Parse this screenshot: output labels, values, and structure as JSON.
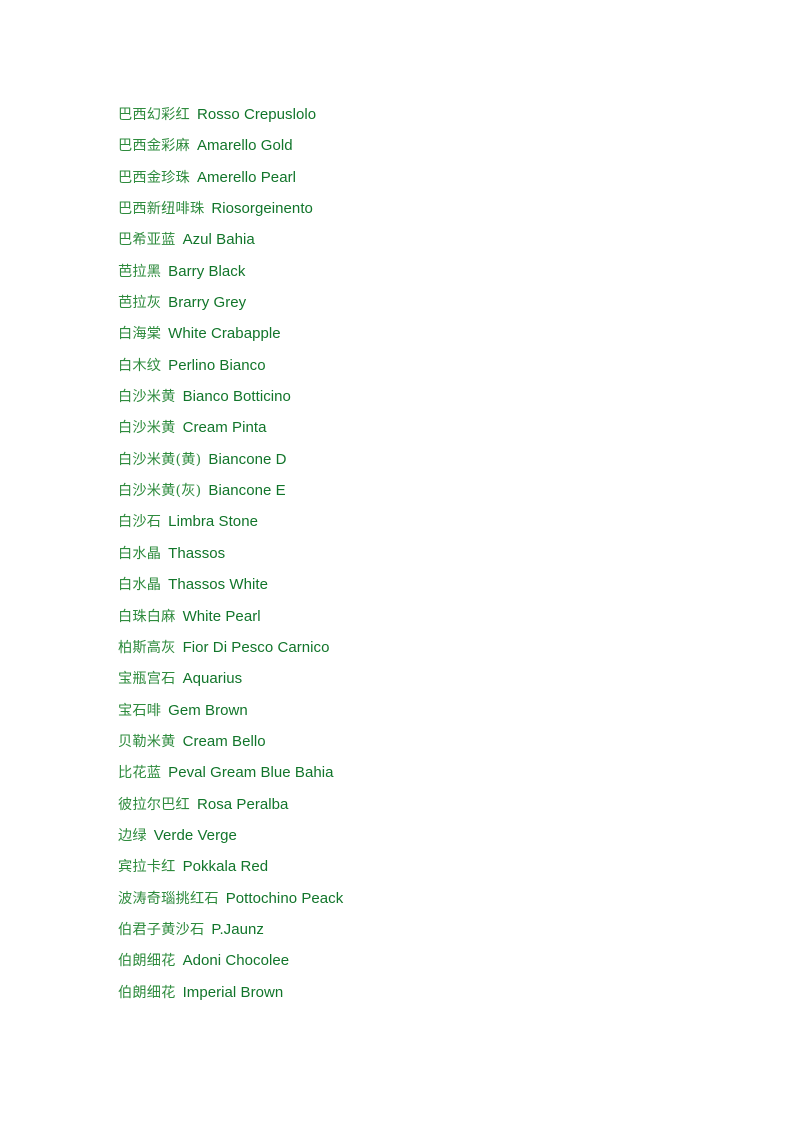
{
  "document": {
    "page_background": "#ffffff",
    "chinese_text_color": "#2e8b3d",
    "latin_text_color": "#11752a",
    "entries": [
      {
        "cn": "巴西幻彩红",
        "en": "Rosso Crepuslolo"
      },
      {
        "cn": "巴西金彩麻",
        "en": "Amarello Gold"
      },
      {
        "cn": "巴西金珍珠",
        "en": "Amerello Pearl"
      },
      {
        "cn": "巴西新纽啡珠",
        "en": "Riosorgeinento"
      },
      {
        "cn": "巴希亚蓝",
        "en": "Azul Bahia"
      },
      {
        "cn": "芭拉黑",
        "en": "Barry Black"
      },
      {
        "cn": "芭拉灰",
        "en": "Brarry Grey"
      },
      {
        "cn": "白海棠",
        "en": "White Crabapple"
      },
      {
        "cn": "白木纹",
        "en": "Perlino Bianco"
      },
      {
        "cn": "白沙米黄",
        "en": "Bianco Botticino"
      },
      {
        "cn": "白沙米黄",
        "en": "Cream Pinta"
      },
      {
        "cn": "白沙米黄(黄)",
        "en": "Biancone D"
      },
      {
        "cn": "白沙米黄(灰)",
        "en": "Biancone E"
      },
      {
        "cn": "白沙石",
        "en": "Limbra Stone"
      },
      {
        "cn": "白水晶",
        "en": "Thassos"
      },
      {
        "cn": "白水晶",
        "en": "Thassos White"
      },
      {
        "cn": "白珠白麻",
        "en": "White Pearl"
      },
      {
        "cn": "柏斯高灰",
        "en": "Fior Di Pesco Carnico"
      },
      {
        "cn": "宝瓶宫石",
        "en": "Aquarius"
      },
      {
        "cn": "宝石啡",
        "en": "Gem Brown"
      },
      {
        "cn": "贝勒米黄",
        "en": "Cream Bello"
      },
      {
        "cn": "比花蓝",
        "en": "Peval Gream Blue Bahia"
      },
      {
        "cn": "彼拉尔巴红",
        "en": "Rosa Peralba"
      },
      {
        "cn": "边绿",
        "en": "Verde Verge"
      },
      {
        "cn": "宾拉卡红",
        "en": "Pokkala Red"
      },
      {
        "cn": "波涛奇瑙挑红石",
        "en": "Pottochino Peack"
      },
      {
        "cn": "伯君子黄沙石",
        "en": "P.Jaunz"
      },
      {
        "cn": "伯朗细花",
        "en": "Adoni Chocolee"
      },
      {
        "cn": "伯朗细花",
        "en": "Imperial Brown"
      }
    ]
  }
}
